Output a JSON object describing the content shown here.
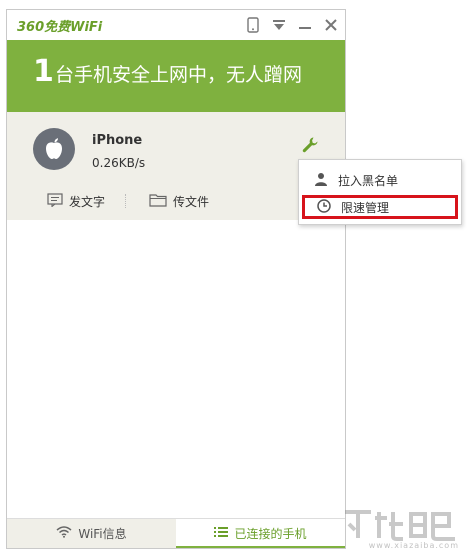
{
  "app": {
    "logo_text": "360免费WiFi"
  },
  "header": {
    "count": "1",
    "text": "台手机安全上网中，无人蹭网"
  },
  "device": {
    "name": "iPhone",
    "speed": "0.26KB/s",
    "actions": [
      {
        "label": "发文字",
        "icon": "message-icon"
      },
      {
        "label": "传文件",
        "icon": "folder-icon"
      }
    ]
  },
  "popup": {
    "items": [
      {
        "label": "拉入黑名单",
        "icon": "user-icon"
      },
      {
        "label": "限速管理",
        "icon": "clock-icon",
        "highlighted": true
      }
    ]
  },
  "tabs": [
    {
      "label": "WiFi信息",
      "icon": "wifi-icon",
      "active": false
    },
    {
      "label": "已连接的手机",
      "icon": "list-icon",
      "active": true
    }
  ],
  "watermark": {
    "text": "www.xiazaiba.com"
  },
  "colors": {
    "brand_green": "#7fb13f",
    "highlight_red": "#d7131b",
    "panel_bg": "#f0efe8"
  }
}
